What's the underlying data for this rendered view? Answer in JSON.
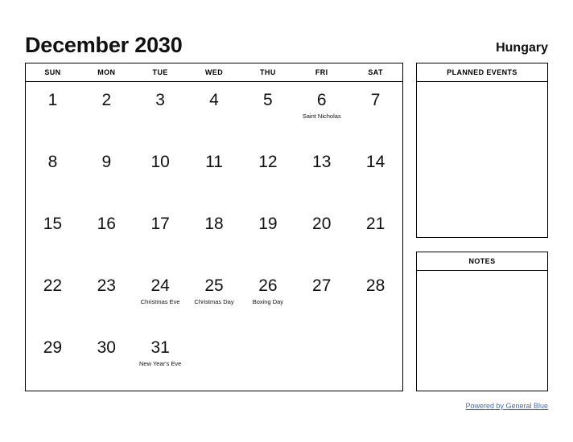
{
  "header": {
    "title": "December 2030",
    "country": "Hungary"
  },
  "calendar": {
    "weekdays": [
      "SUN",
      "MON",
      "TUE",
      "WED",
      "THU",
      "FRI",
      "SAT"
    ],
    "weeks": [
      [
        {
          "day": "1",
          "event": ""
        },
        {
          "day": "2",
          "event": ""
        },
        {
          "day": "3",
          "event": ""
        },
        {
          "day": "4",
          "event": ""
        },
        {
          "day": "5",
          "event": ""
        },
        {
          "day": "6",
          "event": "Saint Nicholas"
        },
        {
          "day": "7",
          "event": ""
        }
      ],
      [
        {
          "day": "8",
          "event": ""
        },
        {
          "day": "9",
          "event": ""
        },
        {
          "day": "10",
          "event": ""
        },
        {
          "day": "11",
          "event": ""
        },
        {
          "day": "12",
          "event": ""
        },
        {
          "day": "13",
          "event": ""
        },
        {
          "day": "14",
          "event": ""
        }
      ],
      [
        {
          "day": "15",
          "event": ""
        },
        {
          "day": "16",
          "event": ""
        },
        {
          "day": "17",
          "event": ""
        },
        {
          "day": "18",
          "event": ""
        },
        {
          "day": "19",
          "event": ""
        },
        {
          "day": "20",
          "event": ""
        },
        {
          "day": "21",
          "event": ""
        }
      ],
      [
        {
          "day": "22",
          "event": ""
        },
        {
          "day": "23",
          "event": ""
        },
        {
          "day": "24",
          "event": "Christmas Eve"
        },
        {
          "day": "25",
          "event": "Christmas Day"
        },
        {
          "day": "26",
          "event": "Boxing Day"
        },
        {
          "day": "27",
          "event": ""
        },
        {
          "day": "28",
          "event": ""
        }
      ],
      [
        {
          "day": "29",
          "event": ""
        },
        {
          "day": "30",
          "event": ""
        },
        {
          "day": "31",
          "event": "New Year's Eve"
        },
        {
          "day": "",
          "event": ""
        },
        {
          "day": "",
          "event": ""
        },
        {
          "day": "",
          "event": ""
        },
        {
          "day": "",
          "event": ""
        }
      ]
    ]
  },
  "panels": {
    "planned_events": {
      "title": "PLANNED EVENTS",
      "content": ""
    },
    "notes": {
      "title": "NOTES",
      "content": ""
    }
  },
  "footer": {
    "link_text": "Powered by General Blue"
  },
  "colors": {
    "link": "#3b6fc4",
    "border": "#000000",
    "text": "#111111",
    "background": "#ffffff"
  }
}
